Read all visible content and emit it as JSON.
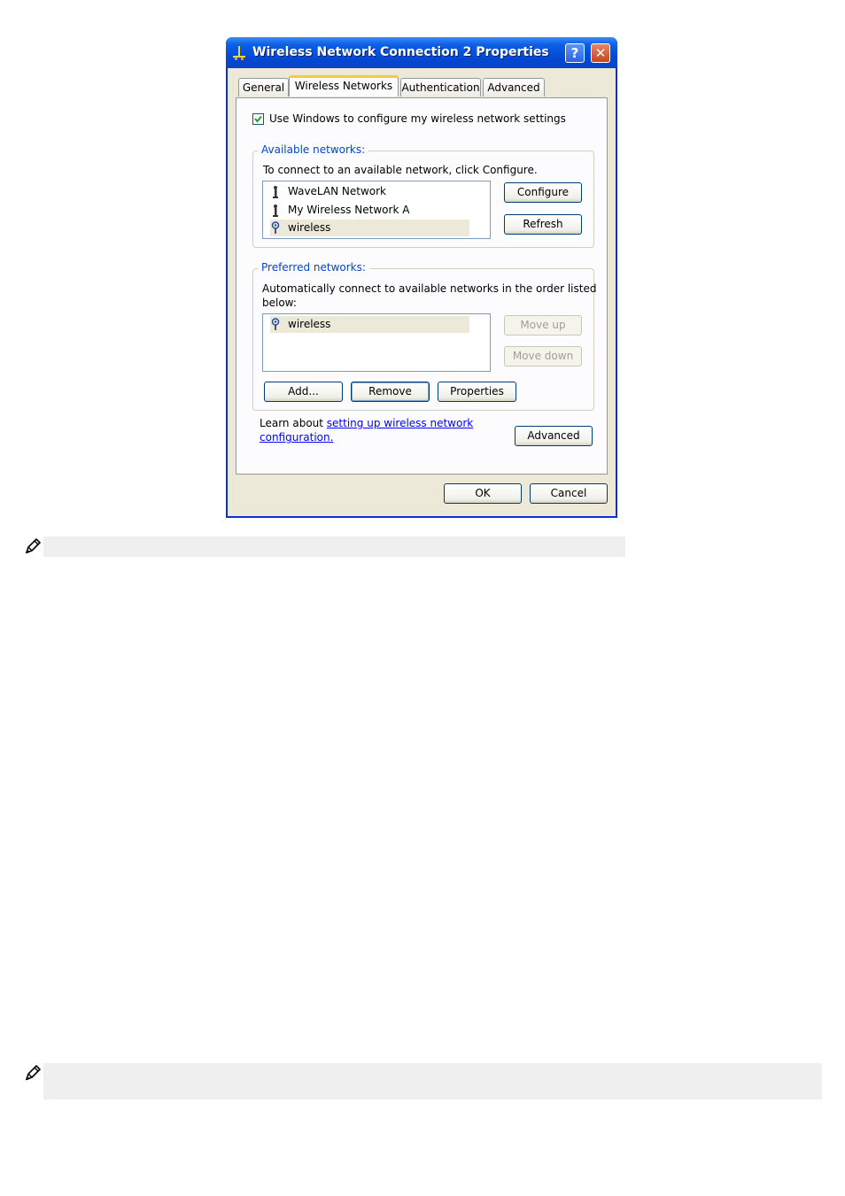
{
  "dialog": {
    "title": "Wireless Network Connection 2 Properties",
    "help_label": "?",
    "close_label": "✕",
    "tabs": [
      {
        "label": "General"
      },
      {
        "label": "Wireless Networks"
      },
      {
        "label": "Authentication"
      },
      {
        "label": "Advanced"
      }
    ],
    "use_windows_label": "Use Windows to configure my wireless network settings",
    "use_windows_checked": true,
    "available": {
      "legend": "Available networks:",
      "description": "To connect to an available network, click Configure.",
      "networks": [
        {
          "name": "WaveLAN Network",
          "icon": "antenna-icon"
        },
        {
          "name": "My Wireless Network A",
          "icon": "antenna-icon"
        },
        {
          "name": "wireless",
          "icon": "preferred-network-icon"
        }
      ],
      "configure_label": "Configure",
      "refresh_label": "Refresh"
    },
    "preferred": {
      "legend": "Preferred networks:",
      "description_line1": "Automatically connect to available networks in the order listed",
      "description_line2": "below:",
      "networks": [
        {
          "name": "wireless",
          "icon": "preferred-network-icon"
        }
      ],
      "move_up_label": "Move up",
      "move_down_label": "Move down",
      "add_label": "Add...",
      "remove_label": "Remove",
      "properties_label": "Properties"
    },
    "learn": {
      "prefix": "Learn about ",
      "link_line1": "setting up wireless network",
      "link_line2": "configuration."
    },
    "advanced_label": "Advanced",
    "ok_label": "OK",
    "cancel_label": "Cancel"
  },
  "notes": [
    {
      "icon": "pencil-note-icon"
    },
    {
      "icon": "pencil-note-icon"
    }
  ],
  "colors": {
    "titlebar": "#0a5fe6",
    "dialog_bg": "#ece9d8",
    "legend": "#0046d5",
    "active_tab_accent": "#ffc83c",
    "note_bar": "#efefef"
  }
}
